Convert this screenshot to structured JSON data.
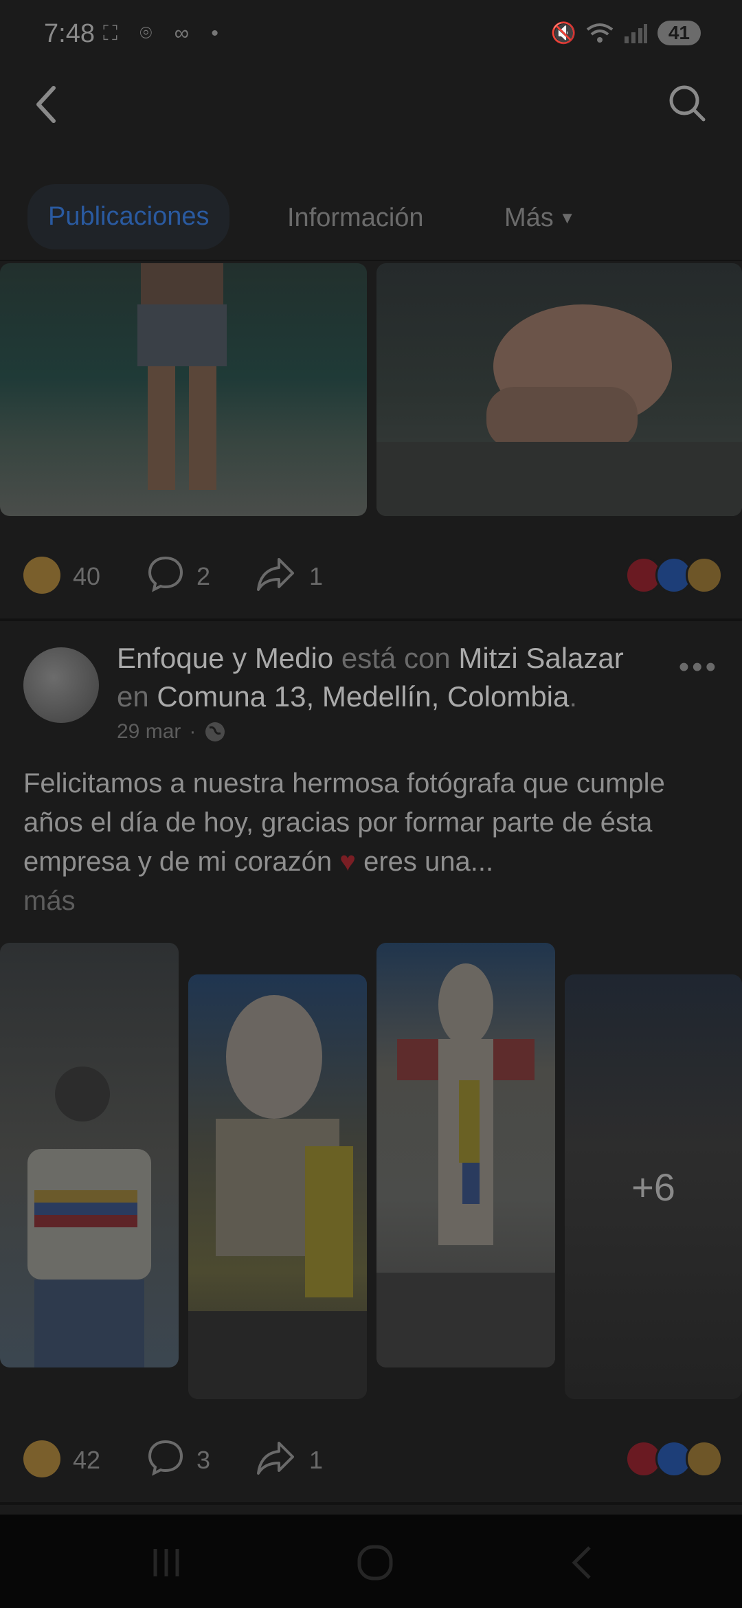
{
  "status_bar": {
    "time": "7:48",
    "left_icons": "⛶ ⌾ ∞ •",
    "battery": "41"
  },
  "header": {
    "back_icon": "chevron-left-icon",
    "search_icon": "search-icon"
  },
  "tabs": [
    {
      "label": "Publicaciones",
      "active": true
    },
    {
      "label": "Información",
      "active": false
    },
    {
      "label": "Más",
      "active": false
    }
  ],
  "post1": {
    "reaction_count": "40",
    "comment_count": "2",
    "share_count": "1"
  },
  "post2": {
    "author": "Enfoque y Medio",
    "with_word": "está con",
    "tagged": "Mitzi Salazar",
    "in_word": "en",
    "location": "Comuna 13, Medellín, Colombia",
    "date": "29 mar",
    "text_before_heart": "Felicitamos a nuestra hermosa fotógrafa que cumple años el día de hoy, gracias por formar parte de ésta empresa y de mi corazón",
    "heart": "♥",
    "text_after_heart": "eres una...",
    "more_label": "más",
    "extra_photos": "+6",
    "reaction_count": "42",
    "comment_count": "3",
    "share_count": "1"
  },
  "colors": {
    "accent_blue": "#2a5aa0",
    "love_red": "#c1233a",
    "like_blue": "#2d6fd8",
    "care_yellow": "#c9a040"
  }
}
